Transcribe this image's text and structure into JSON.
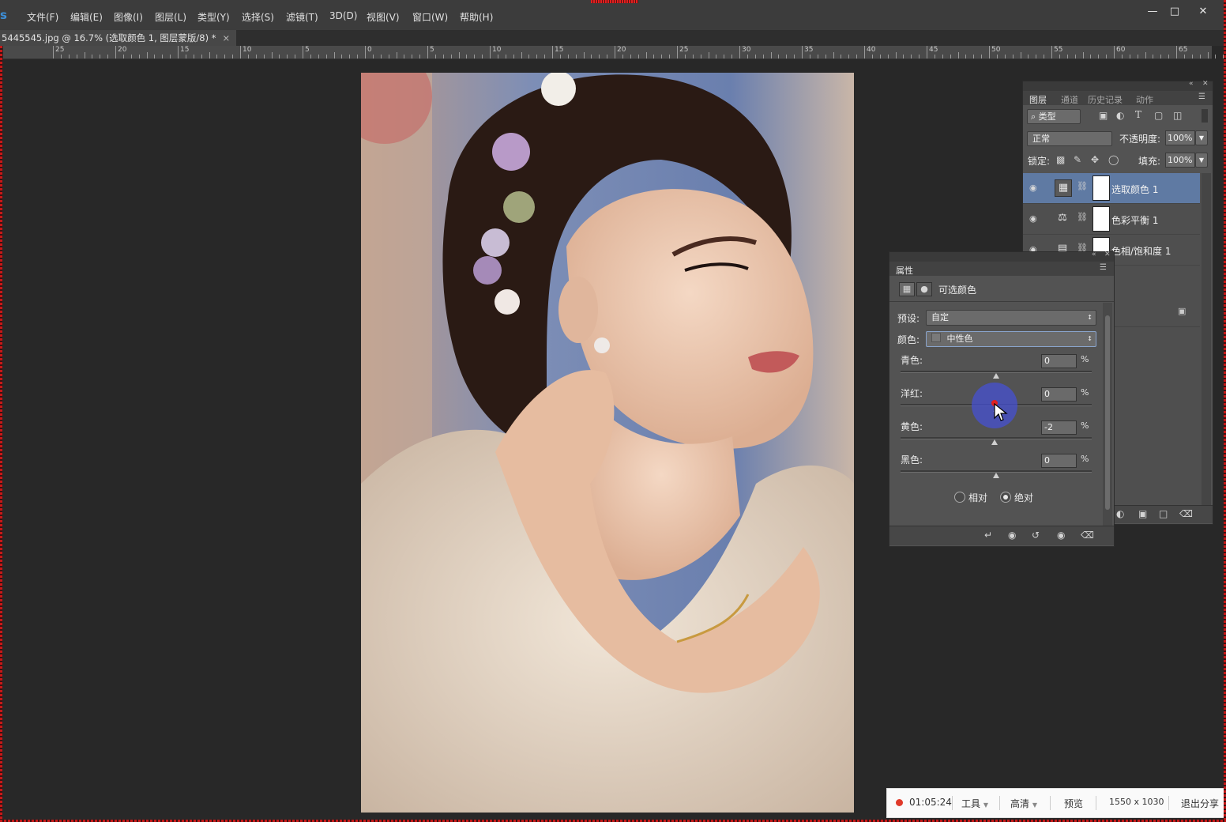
{
  "app": {
    "logo": "s",
    "menu": [
      "文件(F)",
      "编辑(E)",
      "图像(I)",
      "图层(L)",
      "类型(Y)",
      "选择(S)",
      "滤镜(T)",
      "3D(D)",
      "视图(V)",
      "窗口(W)",
      "帮助(H)"
    ]
  },
  "document": {
    "tab_title": "5445545.jpg @ 16.7% (选取颜色 1, 图层蒙版/8) *",
    "close_glyph": "×"
  },
  "ruler": {
    "labels": [
      "25",
      "20",
      "15",
      "10",
      "5",
      "0",
      "5",
      "10",
      "15",
      "20",
      "25",
      "30",
      "35",
      "40",
      "45",
      "50",
      "55",
      "60",
      "65"
    ]
  },
  "layers_panel": {
    "tabs": [
      "图层",
      "通道",
      "历史记录",
      "动作"
    ],
    "filter_kind": "类型",
    "blend_mode": "正常",
    "opacity_label": "不透明度:",
    "opacity_value": "100%",
    "lock_label": "锁定:",
    "fill_label": "填充:",
    "fill_value": "100%",
    "layers": [
      {
        "name": "选取颜色 1",
        "icon": "selective-color-icon",
        "selected": true
      },
      {
        "name": "色彩平衡 1",
        "icon": "color-balance-icon",
        "selected": false
      },
      {
        "name": "色相/饱和度 1",
        "icon": "hue-saturation-icon",
        "selected": false
      }
    ]
  },
  "properties_panel": {
    "tab": "属性",
    "title": "可选颜色",
    "preset_label": "预设:",
    "preset_value": "自定",
    "colors_label": "颜色:",
    "colors_value": "中性色",
    "sliders": [
      {
        "label": "青色:",
        "value": "0",
        "fraction": 0.5
      },
      {
        "label": "洋红:",
        "value": "0",
        "fraction": 0.5
      },
      {
        "label": "黄色:",
        "value": "-2",
        "fraction": 0.49
      },
      {
        "label": "黑色:",
        "value": "0",
        "fraction": 0.5
      }
    ],
    "percent_sign": "%",
    "method_relative": "相对",
    "method_absolute": "绝对",
    "method_selected": "absolute"
  },
  "recorder": {
    "time": "01:05:24",
    "tools": "工具",
    "quality": "高清",
    "preview": "预览",
    "resolution": "1550 x 1030",
    "exit": "退出分享",
    "dot_color": "#e03a2a"
  }
}
